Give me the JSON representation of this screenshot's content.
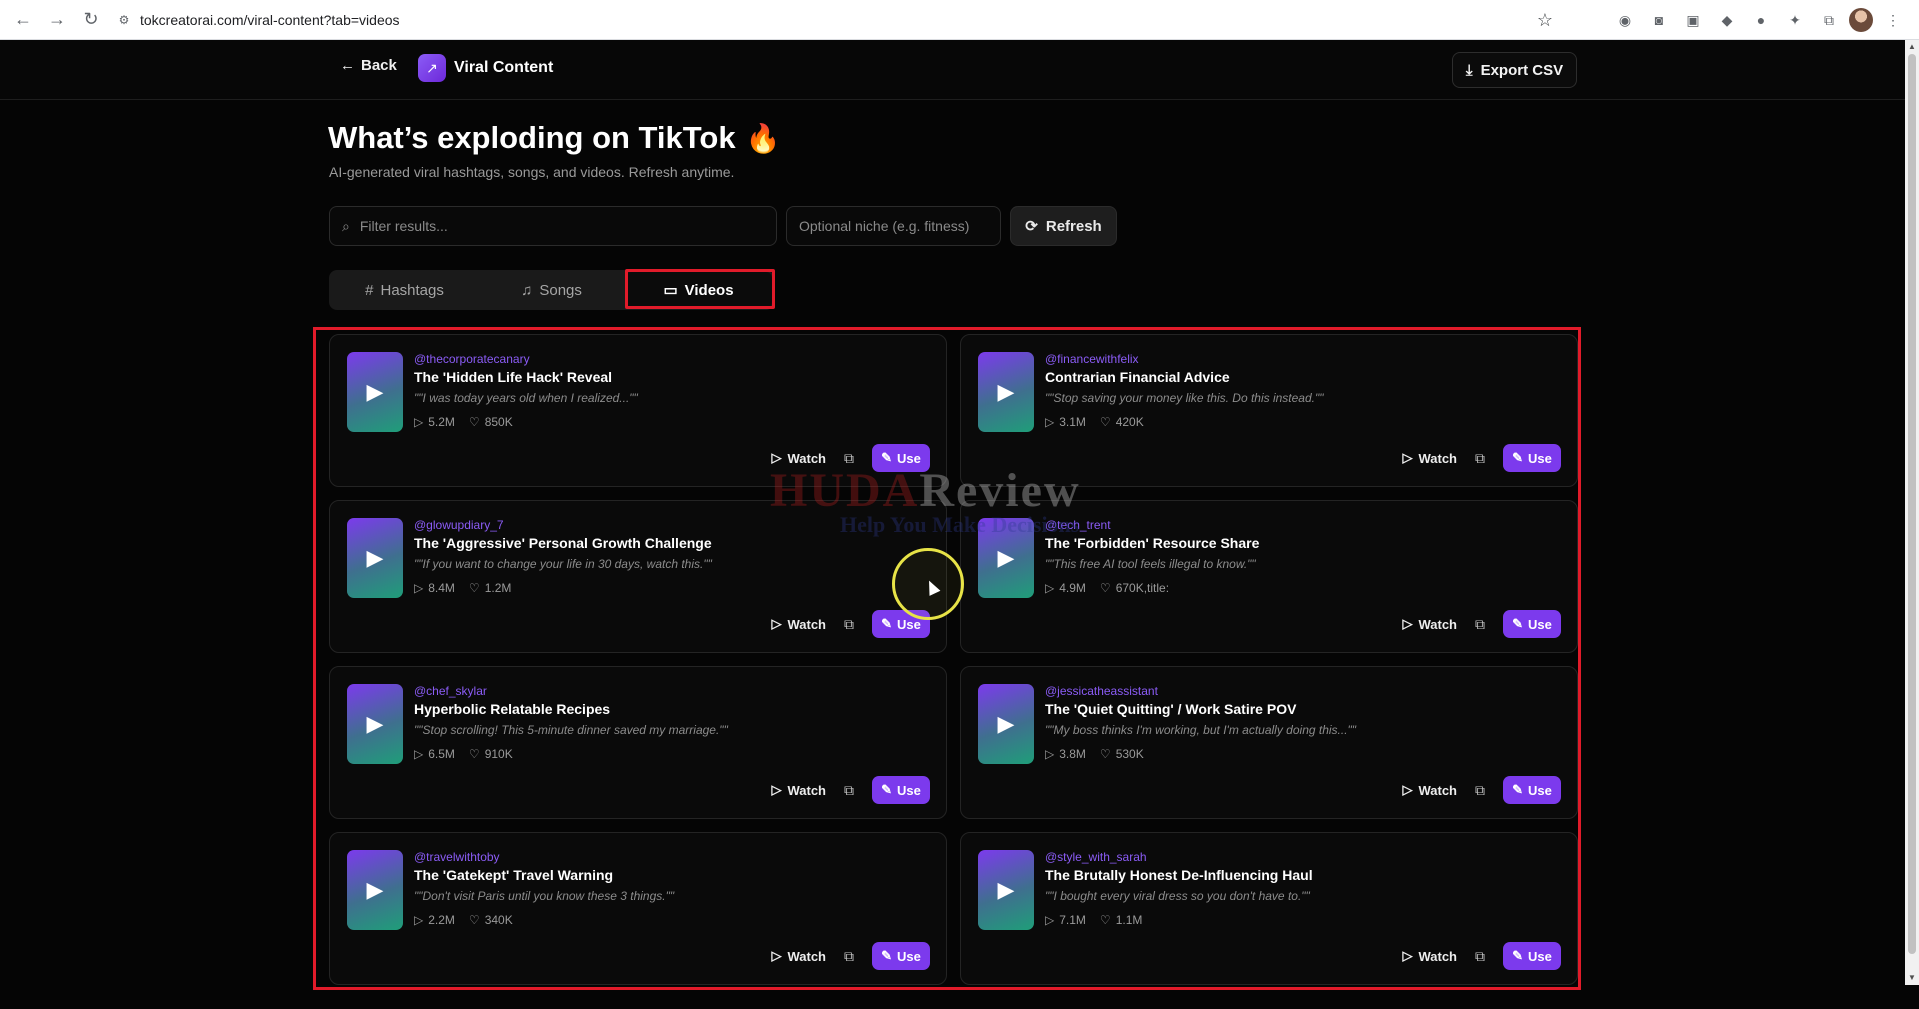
{
  "browser": {
    "url": "tokcreatorai.com/viral-content?tab=videos",
    "back_icon": "arrow-left-icon",
    "forward_icon": "arrow-right-icon",
    "reload_icon": "reload-icon"
  },
  "header": {
    "back_label": "Back",
    "app_title": "Viral Content",
    "export_label": "Export CSV"
  },
  "hero": {
    "title": "What’s exploding on TikTok",
    "subtitle": "AI-generated viral hashtags, songs, and videos. Refresh anytime."
  },
  "controls": {
    "filter_placeholder": "Filter results...",
    "niche_placeholder": "Optional niche (e.g. fitness)",
    "refresh_label": "Refresh"
  },
  "tabs": [
    {
      "label": "Hashtags",
      "icon": "#"
    },
    {
      "label": "Songs",
      "icon": "♫"
    },
    {
      "label": "Videos",
      "icon": "▭"
    }
  ],
  "active_tab": "Videos",
  "card_labels": {
    "watch": "Watch",
    "use": "Use"
  },
  "videos": [
    {
      "handle": "@thecorporatecanary",
      "title": "The 'Hidden Life Hack' Reveal",
      "quote": "\"\"I was today years old when I realized...\"\"",
      "views": "5.2M",
      "likes": "850K"
    },
    {
      "handle": "@financewithfelix",
      "title": "Contrarian Financial Advice",
      "quote": "\"\"Stop saving your money like this. Do this instead.\"\"",
      "views": "3.1M",
      "likes": "420K"
    },
    {
      "handle": "@glowupdiary_7",
      "title": "The 'Aggressive' Personal Growth Challenge",
      "quote": "\"\"If you want to change your life in 30 days, watch this.\"\"",
      "views": "8.4M",
      "likes": "1.2M"
    },
    {
      "handle": "@tech_trent",
      "title": "The 'Forbidden' Resource Share",
      "quote": "\"\"This free AI tool feels illegal to know.\"\"",
      "views": "4.9M",
      "likes": "670K,title:"
    },
    {
      "handle": "@chef_skylar",
      "title": "Hyperbolic Relatable Recipes",
      "quote": "\"\"Stop scrolling! This 5-minute dinner saved my marriage.\"\"",
      "views": "6.5M",
      "likes": "910K"
    },
    {
      "handle": "@jessicatheassistant",
      "title": "The 'Quiet Quitting' / Work Satire POV",
      "quote": "\"\"My boss thinks I'm working, but I'm actually doing this...\"\"",
      "views": "3.8M",
      "likes": "530K"
    },
    {
      "handle": "@travelwithtoby",
      "title": "The 'Gatekept' Travel Warning",
      "quote": "\"\"Don't visit Paris until you know these 3 things.\"\"",
      "views": "2.2M",
      "likes": "340K"
    },
    {
      "handle": "@style_with_sarah",
      "title": "The Brutally Honest De-Influencing Haul",
      "quote": "\"\"I bought every viral dress so you don't have to.\"\"",
      "views": "7.1M",
      "likes": "1.1M"
    }
  ],
  "watermark": {
    "main": "HUDA",
    "sub": "Help You Make Decisions"
  },
  "colors": {
    "accent": "#7c3aed",
    "handle": "#8b5cf6",
    "highlight": "#e11b2a",
    "background": "#050505"
  }
}
